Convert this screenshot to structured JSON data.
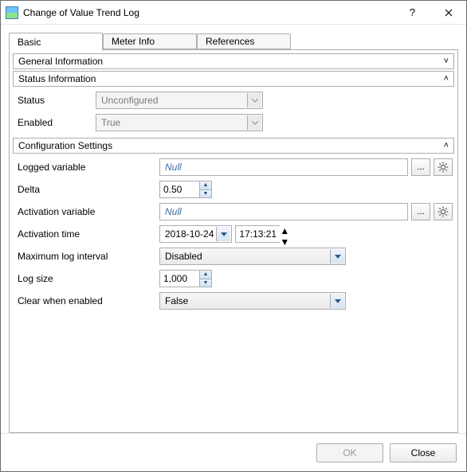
{
  "window": {
    "title": "Change of Value Trend Log"
  },
  "tabs": {
    "basic": "Basic",
    "meter": "Meter Info",
    "refs": "References"
  },
  "sections": {
    "general": "General Information",
    "status": "Status Information",
    "config": "Configuration Settings"
  },
  "status": {
    "status_label": "Status",
    "status_value": "Unconfigured",
    "enabled_label": "Enabled",
    "enabled_value": "True"
  },
  "config": {
    "logged_label": "Logged variable",
    "logged_value": "Null",
    "delta_label": "Delta",
    "delta_value": "0.50",
    "activation_var_label": "Activation variable",
    "activation_var_value": "Null",
    "activation_time_label": "Activation time",
    "activation_date": "2018-10-24",
    "activation_time": "17:13:21",
    "max_interval_label": "Maximum log interval",
    "max_interval_value": "Disabled",
    "log_size_label": "Log size",
    "log_size_value": "1,000",
    "clear_label": "Clear when enabled",
    "clear_value": "False"
  },
  "buttons": {
    "ok": "OK",
    "close": "Close",
    "ellipsis": "...",
    "help": "?"
  },
  "glyphs": {
    "down": "˅",
    "up": "˄",
    "tri_up": "▲",
    "tri_down": "▼"
  }
}
